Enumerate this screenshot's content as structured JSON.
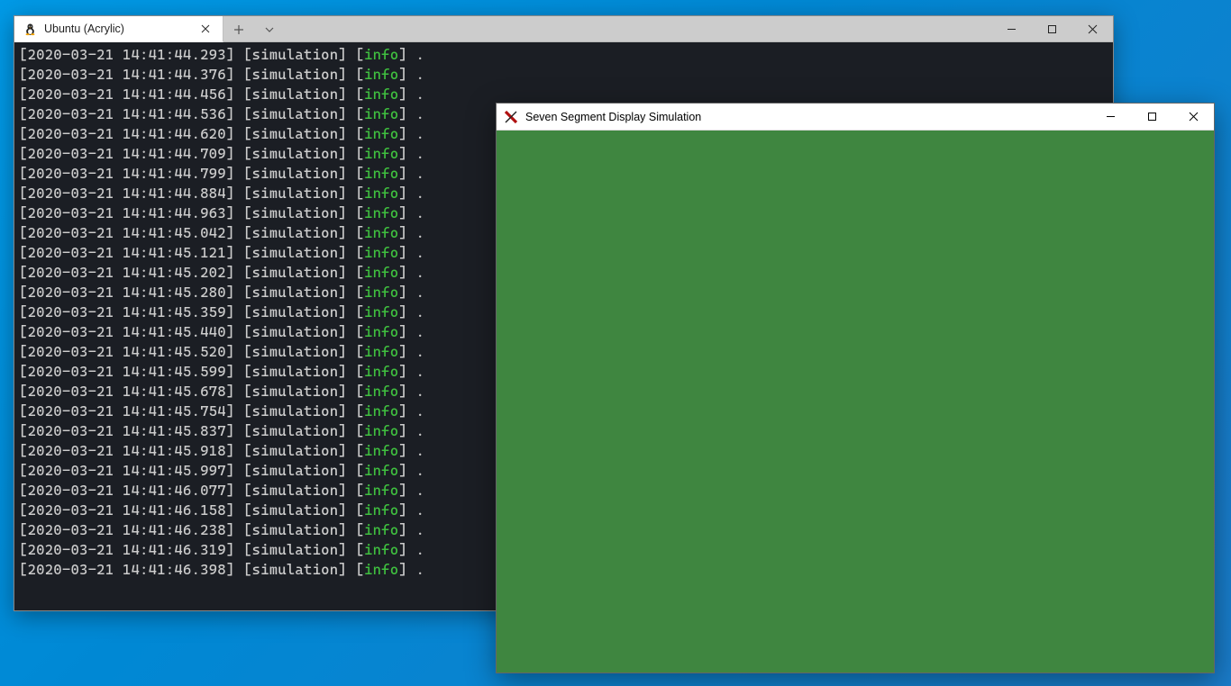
{
  "terminal": {
    "tab_title": "Ubuntu (Acrylic)",
    "tab_icon": "tux-icon",
    "log_module": "simulation",
    "log_level": "info",
    "log_message": ".",
    "timestamps": [
      "2020-03-21 14:41:44.293",
      "2020-03-21 14:41:44.376",
      "2020-03-21 14:41:44.456",
      "2020-03-21 14:41:44.536",
      "2020-03-21 14:41:44.620",
      "2020-03-21 14:41:44.709",
      "2020-03-21 14:41:44.799",
      "2020-03-21 14:41:44.884",
      "2020-03-21 14:41:44.963",
      "2020-03-21 14:41:45.042",
      "2020-03-21 14:41:45.121",
      "2020-03-21 14:41:45.202",
      "2020-03-21 14:41:45.280",
      "2020-03-21 14:41:45.359",
      "2020-03-21 14:41:45.440",
      "2020-03-21 14:41:45.520",
      "2020-03-21 14:41:45.599",
      "2020-03-21 14:41:45.678",
      "2020-03-21 14:41:45.754",
      "2020-03-21 14:41:45.837",
      "2020-03-21 14:41:45.918",
      "2020-03-21 14:41:45.997",
      "2020-03-21 14:41:46.077",
      "2020-03-21 14:41:46.158",
      "2020-03-21 14:41:46.238",
      "2020-03-21 14:41:46.319",
      "2020-03-21 14:41:46.398"
    ]
  },
  "sim_window": {
    "title": "Seven Segment Display Simulation",
    "icon": "x11-icon",
    "canvas_color": "#3f8640"
  }
}
